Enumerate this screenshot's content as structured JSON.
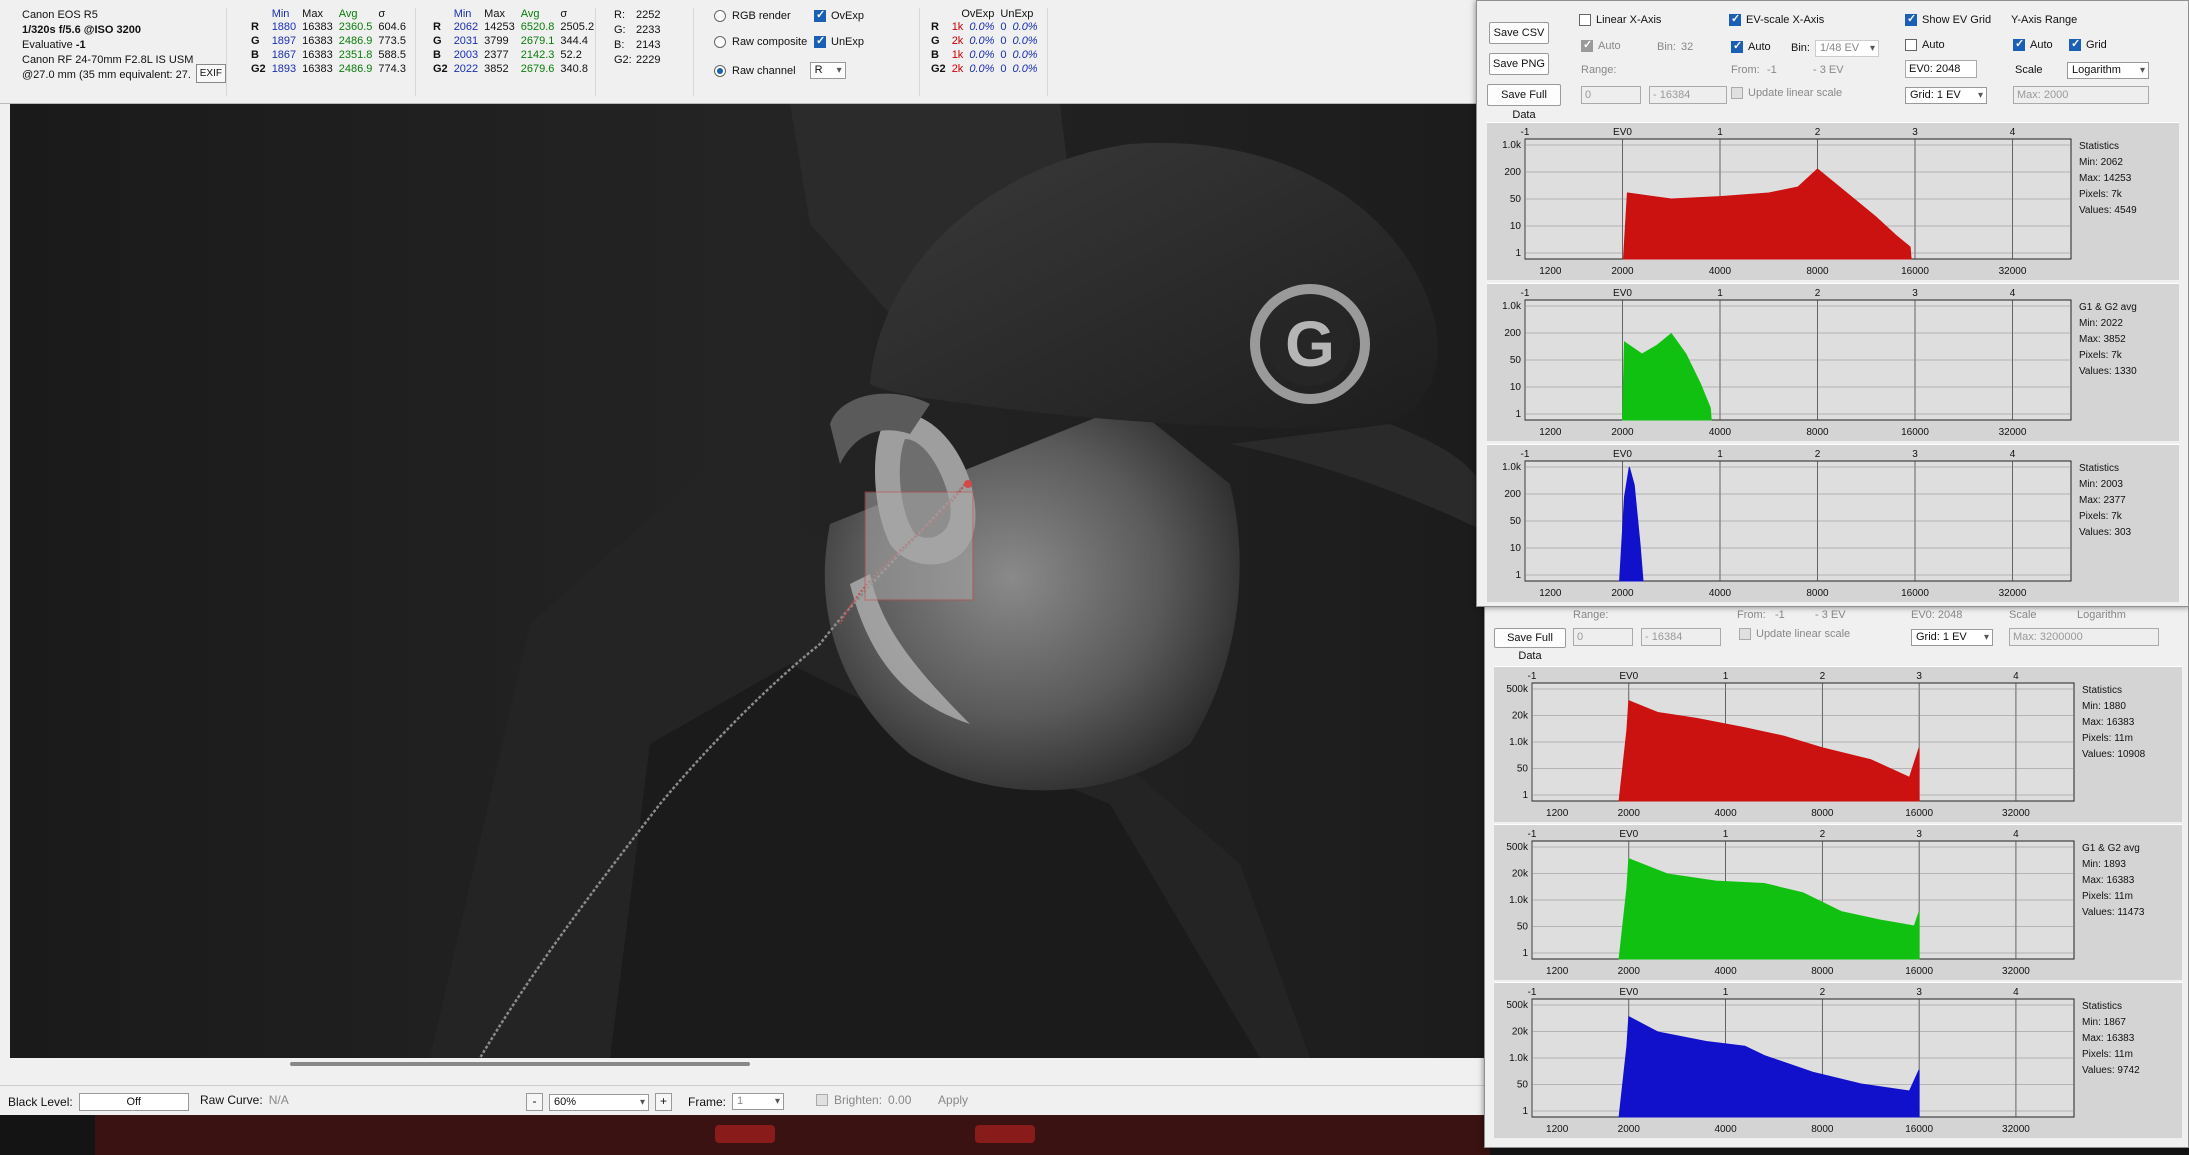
{
  "camera": {
    "model": "Canon EOS R5",
    "exposure": "1/320s f/5.6 @ISO 3200",
    "metering_label": "Evaluative",
    "metering_value": "-1",
    "lens": "Canon RF 24-70mm F2.8L IS USM",
    "focal": "@27.0 mm (35 mm equivalent: 27.",
    "exif_button": "EXIF"
  },
  "stats_full": {
    "headers": [
      "Min",
      "Max",
      "Avg",
      "σ"
    ],
    "rows": [
      {
        "ch": "R",
        "min": "1880",
        "max": "16383",
        "avg": "2360.5",
        "sd": "604.6"
      },
      {
        "ch": "G",
        "min": "1897",
        "max": "16383",
        "avg": "2486.9",
        "sd": "773.5"
      },
      {
        "ch": "B",
        "min": "1867",
        "max": "16383",
        "avg": "2351.8",
        "sd": "588.5"
      },
      {
        "ch": "G2",
        "min": "1893",
        "max": "16383",
        "avg": "2486.9",
        "sd": "774.3"
      }
    ]
  },
  "stats_sel": {
    "headers": [
      "Min",
      "Max",
      "Avg",
      "σ"
    ],
    "rows": [
      {
        "ch": "R",
        "min": "2062",
        "max": "14253",
        "avg": "6520.8",
        "sd": "2505.2"
      },
      {
        "ch": "G",
        "min": "2031",
        "max": "3799",
        "avg": "2679.1",
        "sd": "344.4"
      },
      {
        "ch": "B",
        "min": "2003",
        "max": "2377",
        "avg": "2142.3",
        "sd": "52.2"
      },
      {
        "ch": "G2",
        "min": "2022",
        "max": "3852",
        "avg": "2679.6",
        "sd": "340.8"
      }
    ]
  },
  "pixel_values": [
    {
      "k": "R:",
      "v": "2252"
    },
    {
      "k": "G:",
      "v": "2233"
    },
    {
      "k": "B:",
      "v": "2143"
    },
    {
      "k": "G2:",
      "v": "2229"
    }
  ],
  "modes": {
    "rgb_render": "RGB render",
    "raw_composite": "Raw composite",
    "raw_channel": "Raw channel",
    "channel_value": "R",
    "ovexp": "OvExp",
    "unexp": "UnExp"
  },
  "ovexp_table": {
    "h1": "OvExp",
    "h2": "UnExp",
    "rows": [
      {
        "ch": "R",
        "ov": "1k",
        "ovp": "0.0%",
        "un": "0",
        "unp": "0.0%"
      },
      {
        "ch": "G",
        "ov": "2k",
        "ovp": "0.0%",
        "un": "0",
        "unp": "0.0%"
      },
      {
        "ch": "B",
        "ov": "1k",
        "ovp": "0.0%",
        "un": "0",
        "unp": "0.0%"
      },
      {
        "ch": "G2",
        "ov": "2k",
        "ovp": "0.0%",
        "un": "0",
        "unp": "0.0%"
      }
    ]
  },
  "bottom": {
    "black_level_label": "Black Level:",
    "black_level_value": "Off",
    "raw_curve_label": "Raw Curve:",
    "raw_curve_value": "N/A",
    "minus": "-",
    "zoom": "60%",
    "plus": "+",
    "frame_label": "Frame:",
    "frame_value": "1",
    "brighten_label": "Brighten:",
    "brighten_value": "0.00",
    "apply": "Apply"
  },
  "hist1": {
    "save_csv": "Save CSV",
    "save_png": "Save PNG",
    "save_full": "Save Full Data",
    "linear_x": "Linear X-Axis",
    "auto": "Auto",
    "bin_label": "Bin:",
    "bin_value": "32",
    "range_label": "Range:",
    "range_from": "0",
    "range_to": "- 16384",
    "ev_scale": "EV-scale X-Axis",
    "ev_auto": "Auto",
    "ev_bin_label": "Bin:",
    "ev_bin_value": "1/48 EV",
    "from_label": "From:",
    "from_value": "-1",
    "to_value": "- 3 EV",
    "update_linear": "Update linear scale",
    "show_ev_grid": "Show EV Grid",
    "grid_auto": "Auto",
    "ev0_value": "EV0: 2048",
    "grid_value": "Grid: 1 EV",
    "y_range": "Y-Axis Range",
    "y_auto": "Auto",
    "y_grid": "Grid",
    "scale_label": "Scale",
    "scale_value": "Logarithm",
    "max_label": "Max: 2000"
  },
  "hist2": {
    "range_label": "Range:",
    "range_from": "0",
    "range_to": "- 16384",
    "from_label": "From:",
    "from_value": "-1",
    "to_value": "- 3 EV",
    "update_linear": "Update linear scale",
    "ev0_value": "EV0: 2048",
    "scale_label": "Scale",
    "scale_value": "Logarithm",
    "save_full": "Save Full Data",
    "grid_value": "Grid: 1 EV",
    "max_label": "Max: 3200000"
  },
  "chart_data": [
    {
      "type": "area",
      "color": "#cc1111",
      "top_ticks": [
        "-1",
        "EV0",
        "1",
        "2",
        "3",
        "4"
      ],
      "x_ticks": [
        "1200",
        "2000",
        "4000",
        "8000",
        "16000",
        "32000"
      ],
      "y_ticks": [
        "1.0k",
        "200",
        "50",
        "10",
        "1"
      ],
      "stats_title": "Statistics",
      "stats": [
        "Min: 2062",
        "Max: 14253",
        "Pixels: 7k",
        "Values: 4549"
      ],
      "ev_range": [
        -1,
        4.6
      ],
      "y_scale": "log",
      "x_ev": [
        0.01,
        0.05,
        0.5,
        1.0,
        1.5,
        1.8,
        2.0,
        2.3,
        2.6,
        2.8,
        2.95,
        2.96
      ],
      "y_frac": [
        0.0,
        0.55,
        0.5,
        0.52,
        0.55,
        0.6,
        0.75,
        0.55,
        0.35,
        0.2,
        0.1,
        0.0
      ]
    },
    {
      "type": "area",
      "color": "#11c111",
      "top_ticks": [
        "-1",
        "EV0",
        "1",
        "2",
        "3",
        "4"
      ],
      "x_ticks": [
        "1200",
        "2000",
        "4000",
        "8000",
        "16000",
        "32000"
      ],
      "y_ticks": [
        "1.0k",
        "200",
        "50",
        "10",
        "1"
      ],
      "stats_title": "G1 & G2 avg",
      "stats": [
        "Min: 2022",
        "Max: 3852",
        "Pixels: 7k",
        "Values: 1330"
      ],
      "ev_range": [
        -1,
        4.6
      ],
      "y_scale": "log",
      "x_ev": [
        0.0,
        0.02,
        0.2,
        0.35,
        0.5,
        0.65,
        0.8,
        0.9,
        0.91
      ],
      "y_frac": [
        0.0,
        0.65,
        0.55,
        0.62,
        0.72,
        0.55,
        0.3,
        0.1,
        0.0
      ]
    },
    {
      "type": "area",
      "color": "#1111cc",
      "top_ticks": [
        "-1",
        "EV0",
        "1",
        "2",
        "3",
        "4"
      ],
      "x_ticks": [
        "1200",
        "2000",
        "4000",
        "8000",
        "16000",
        "32000"
      ],
      "y_ticks": [
        "1.0k",
        "200",
        "50",
        "10",
        "1"
      ],
      "stats_title": "Statistics",
      "stats": [
        "Min: 2003",
        "Max: 2377",
        "Pixels: 7k",
        "Values: 303"
      ],
      "ev_range": [
        -1,
        4.6
      ],
      "y_scale": "log",
      "x_ev": [
        -0.03,
        0.02,
        0.07,
        0.12,
        0.18,
        0.21
      ],
      "y_frac": [
        0.0,
        0.7,
        0.95,
        0.8,
        0.3,
        0.0
      ]
    },
    {
      "type": "area",
      "color": "#cc1111",
      "top_ticks": [
        "-1",
        "EV0",
        "1",
        "2",
        "3",
        "4"
      ],
      "x_ticks": [
        "1200",
        "2000",
        "4000",
        "8000",
        "16000",
        "32000"
      ],
      "y_ticks": [
        "500k",
        "20k",
        "1.0k",
        "50",
        "1"
      ],
      "stats_title": "Statistics",
      "stats": [
        "Min: 1880",
        "Max: 16383",
        "Pixels: 11m",
        "Values: 10908"
      ],
      "ev_range": [
        -1,
        4.6
      ],
      "y_scale": "log",
      "x_ev": [
        -0.1,
        -0.02,
        0.0,
        0.3,
        0.7,
        1.2,
        1.6,
        2.0,
        2.5,
        2.9,
        3.0,
        3.0
      ],
      "y_frac": [
        0.0,
        0.6,
        0.85,
        0.75,
        0.7,
        0.62,
        0.55,
        0.45,
        0.35,
        0.2,
        0.45,
        0.0
      ]
    },
    {
      "type": "area",
      "color": "#11c111",
      "top_ticks": [
        "-1",
        "EV0",
        "1",
        "2",
        "3",
        "4"
      ],
      "x_ticks": [
        "1200",
        "2000",
        "4000",
        "8000",
        "16000",
        "32000"
      ],
      "y_ticks": [
        "500k",
        "20k",
        "1.0k",
        "50",
        "1"
      ],
      "stats_title": "G1 & G2 avg",
      "stats": [
        "Min: 1893",
        "Max: 16383",
        "Pixels: 11m",
        "Values: 11473"
      ],
      "ev_range": [
        -1,
        4.6
      ],
      "y_scale": "log",
      "x_ev": [
        -0.1,
        -0.02,
        0.0,
        0.4,
        0.9,
        1.4,
        1.8,
        2.2,
        2.6,
        2.95,
        3.0,
        3.0
      ],
      "y_frac": [
        0.0,
        0.6,
        0.85,
        0.72,
        0.66,
        0.64,
        0.56,
        0.4,
        0.33,
        0.28,
        0.4,
        0.0
      ]
    },
    {
      "type": "area",
      "color": "#1111cc",
      "top_ticks": [
        "-1",
        "EV0",
        "1",
        "2",
        "3",
        "4"
      ],
      "x_ticks": [
        "1200",
        "2000",
        "4000",
        "8000",
        "16000",
        "32000"
      ],
      "y_ticks": [
        "500k",
        "20k",
        "1.0k",
        "50",
        "1"
      ],
      "stats_title": "Statistics",
      "stats": [
        "Min: 1867",
        "Max: 16383",
        "Pixels: 11m",
        "Values: 9742"
      ],
      "ev_range": [
        -1,
        4.6
      ],
      "y_scale": "log",
      "x_ev": [
        -0.1,
        -0.02,
        0.0,
        0.3,
        0.8,
        1.2,
        1.4,
        1.9,
        2.4,
        2.9,
        3.0,
        3.0
      ],
      "y_frac": [
        0.0,
        0.6,
        0.85,
        0.72,
        0.64,
        0.6,
        0.52,
        0.38,
        0.28,
        0.22,
        0.4,
        0.0
      ]
    }
  ]
}
